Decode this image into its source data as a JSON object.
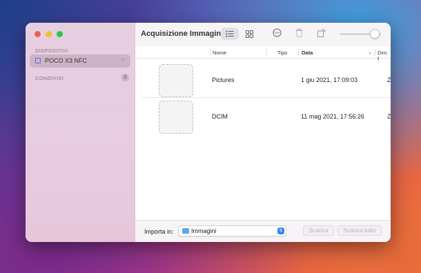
{
  "window": {
    "title": "Acquisizione Immagine"
  },
  "sidebar": {
    "devices_header": "DISPOSITIVI",
    "device_name": "POCO X3 NFC",
    "shared_header": "CONDIVISI",
    "shared_count": "0"
  },
  "columns": {
    "name": "Nome",
    "type": "Tipo",
    "date": "Data",
    "size": "Dim. f"
  },
  "files": [
    {
      "name": "Pictures",
      "type": "",
      "date": "1 giu 2021, 17:09:03",
      "size": "Z"
    },
    {
      "name": "DCIM",
      "type": "",
      "date": "11 mag 2021, 17:56:26",
      "size": "Z"
    }
  ],
  "bottom": {
    "import_label": "Importa in:",
    "import_value": "Immagini",
    "download_button": "Scarica",
    "download_all_button": "Scarica tutto"
  },
  "icons": {
    "list_view": "list-view-icon",
    "grid_view": "grid-view-icon",
    "more": "ellipsis-circle-icon",
    "delete": "trash-icon",
    "rotate": "rotate-icon",
    "folder": "folder-icon"
  },
  "colors": {
    "accent": "#3b82f6",
    "close": "#ef5f57",
    "minimize": "#f6be2f",
    "zoom": "#2ac840"
  }
}
